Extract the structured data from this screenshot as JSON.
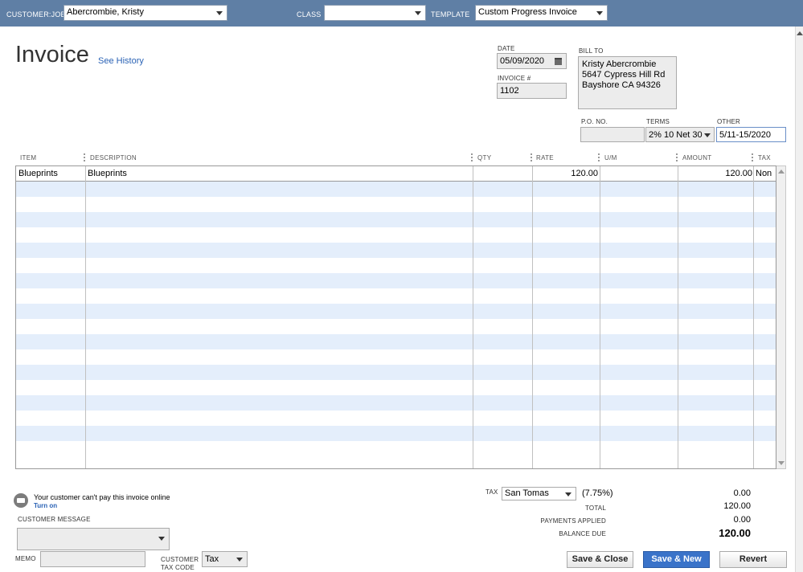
{
  "header": {
    "customer_job_label": "CUSTOMER:JOB",
    "customer_job_value": "Abercrombie, Kristy",
    "class_label": "CLASS",
    "class_value": "",
    "template_label": "TEMPLATE",
    "template_value": "Custom Progress Invoice"
  },
  "form": {
    "title": "Invoice",
    "see_history": "See History",
    "date_label": "DATE",
    "date_value": "05/09/2020",
    "invoice_no_label": "INVOICE #",
    "invoice_no_value": "1102",
    "bill_to_label": "BILL TO",
    "bill_to_lines": [
      "Kristy Abercrombie",
      "5647 Cypress Hill Rd",
      "Bayshore CA 94326"
    ],
    "po_label": "P.O. NO.",
    "po_value": "",
    "terms_label": "TERMS",
    "terms_value": "2% 10 Net 30",
    "other_label": "OTHER",
    "other_value": "5/11-15/2020"
  },
  "table": {
    "columns": [
      "ITEM",
      "DESCRIPTION",
      "QTY",
      "RATE",
      "U/M",
      "AMOUNT",
      "TAX"
    ],
    "rows": [
      {
        "item": "Blueprints",
        "description": "Blueprints",
        "qty": "",
        "rate": "120.00",
        "um": "",
        "amount": "120.00",
        "tax": "Non"
      }
    ]
  },
  "bottom": {
    "online_msg": "Your customer can't pay this invoice online",
    "turn_on": "Turn on",
    "customer_message_label": "CUSTOMER MESSAGE",
    "memo_label": "MEMO",
    "customer_tax_code_label_1": "CUSTOMER",
    "customer_tax_code_label_2": "TAX CODE",
    "customer_tax_code_value": "Tax",
    "tax_label": "TAX",
    "tax_item": "San Tomas",
    "tax_rate": "(7.75%)",
    "tax_amount": "0.00",
    "total_label": "TOTAL",
    "total_value": "120.00",
    "payments_applied_label": "PAYMENTS APPLIED",
    "payments_applied_value": "0.00",
    "balance_due_label": "BALANCE DUE",
    "balance_due_value": "120.00"
  },
  "buttons": {
    "save_close": "Save & Close",
    "save_new": "Save & New",
    "revert": "Revert"
  },
  "colors": {
    "topbar": "#5f7fa5",
    "row_stripe": "#e4eefb",
    "link": "#2a62b5",
    "primary_button": "#3a73c9"
  }
}
